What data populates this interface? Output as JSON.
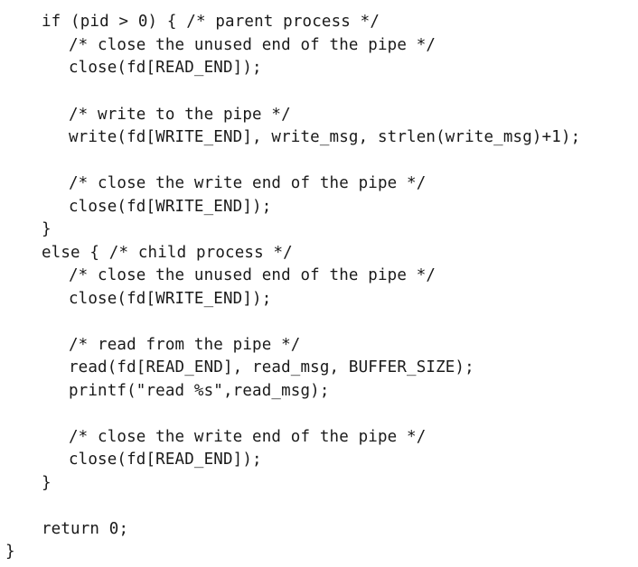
{
  "code": {
    "lines": [
      "if (pid > 0) { /* parent process */",
      "/* close the unused end of the pipe */",
      "close(fd[READ_END]);",
      "",
      "/* write to the pipe */",
      "write(fd[WRITE_END], write_msg, strlen(write_msg)+1);",
      "",
      "/* close the write end of the pipe */",
      "close(fd[WRITE_END]);",
      "}",
      "else { /* child process */",
      "/* close the unused end of the pipe */",
      "close(fd[WRITE_END]);",
      "",
      "/* read from the pipe */",
      "read(fd[READ_END], read_msg, BUFFER_SIZE);",
      "printf(\"read %s\",read_msg);",
      "",
      "/* close the write end of the pipe */",
      "close(fd[READ_END]);",
      "}",
      "",
      "return 0;",
      "}"
    ]
  }
}
